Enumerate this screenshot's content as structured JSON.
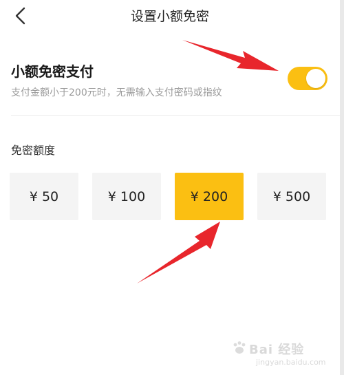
{
  "nav": {
    "title": "设置小额免密",
    "back_icon": "chevron-left-icon"
  },
  "switch": {
    "title": "小额免密支付",
    "description": "支付金额小于200元时，无需输入支付密码或指纹",
    "enabled": true
  },
  "amounts": {
    "label": "免密额度",
    "selected": "¥ 200",
    "options": [
      {
        "label": "¥ 50"
      },
      {
        "label": "¥ 100"
      },
      {
        "label": "¥ 200"
      },
      {
        "label": "¥ 500"
      }
    ]
  },
  "watermark": {
    "brand": "Bai 经验",
    "url": "jingyan.baidu.com"
  },
  "colors": {
    "accent": "#fbbf12",
    "option_bg": "#f4f4f4",
    "annotation_arrow": "#e8262c"
  }
}
